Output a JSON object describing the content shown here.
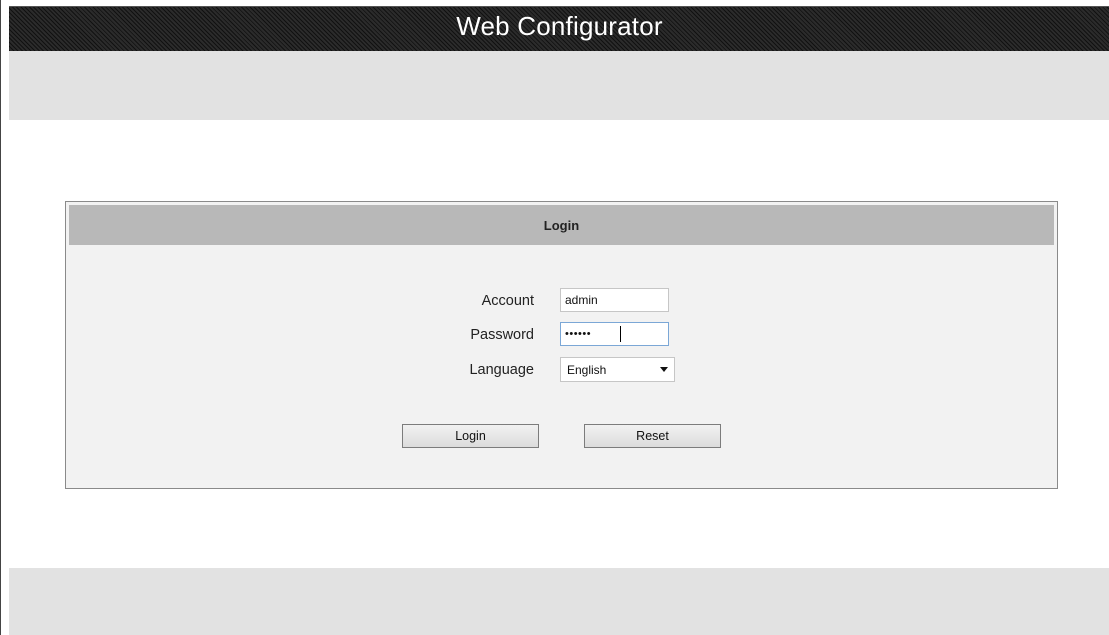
{
  "header": {
    "title": "Web Configurator"
  },
  "login": {
    "panel_title": "Login",
    "account": {
      "label": "Account",
      "value": "admin"
    },
    "password": {
      "label": "Password",
      "masked_value": "••••••"
    },
    "language": {
      "label": "Language",
      "selected": "English"
    },
    "buttons": {
      "login_label": "Login",
      "reset_label": "Reset"
    }
  },
  "icons": {
    "dropdown": "chevron-down-icon"
  },
  "colors": {
    "titlebar": "#1a1a1a",
    "band": "#e2e2e2",
    "panel_header": "#b8b8b8",
    "panel_body": "#f2f2f2"
  }
}
